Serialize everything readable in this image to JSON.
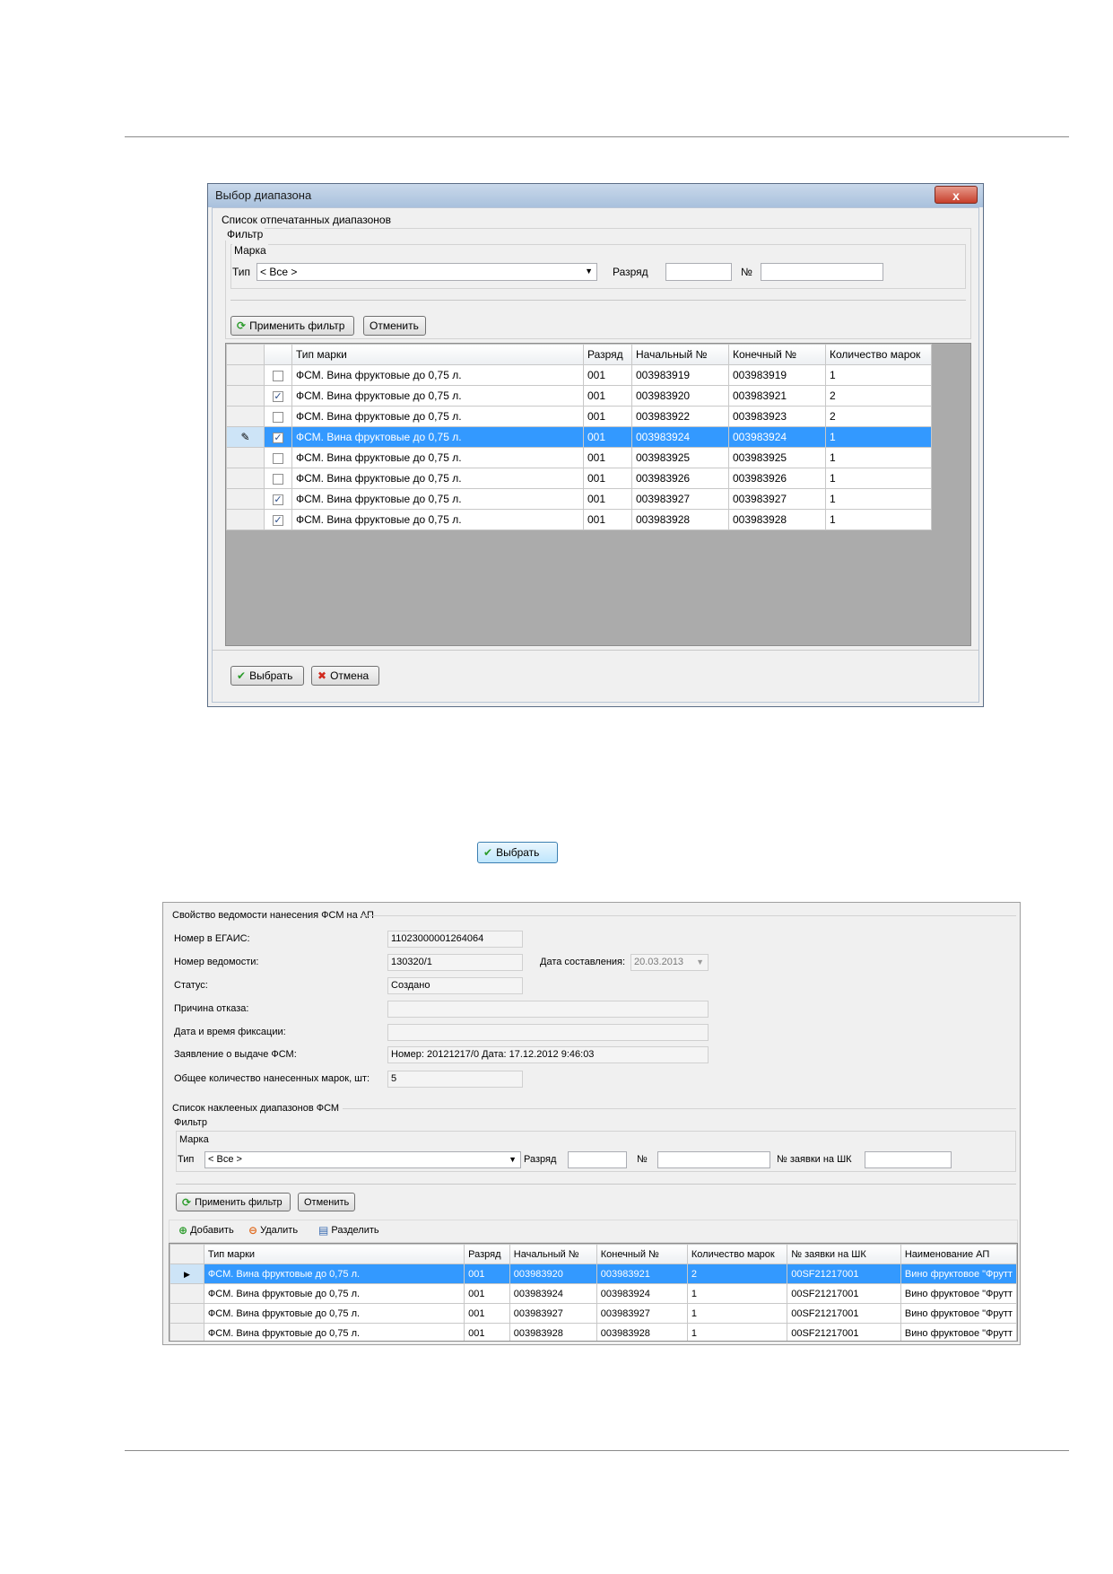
{
  "dialog": {
    "title": "Выбор диапазона",
    "close_glyph": "x",
    "section_label": "Список отпечатанных диапазонов",
    "filter_label": "Фильтр",
    "mark_label": "Марка",
    "type_label": "Тип",
    "type_value": "< Все >",
    "razryad_label": "Разряд",
    "razryad_value": "",
    "number_label": "№",
    "number_value": "",
    "apply_filter": "Применить фильтр",
    "cancel_filter": "Отменить",
    "columns": [
      "Тип марки",
      "Разряд",
      "Начальный №",
      "Конечный №",
      "Количество марок"
    ],
    "rows": [
      {
        "checked": false,
        "type": "ФСМ. Вина фруктовые до 0,75 л.",
        "razryad": "001",
        "start": "003983919",
        "end": "003983919",
        "count": "1"
      },
      {
        "checked": true,
        "type": "ФСМ. Вина фруктовые до 0,75 л.",
        "razryad": "001",
        "start": "003983920",
        "end": "003983921",
        "count": "2"
      },
      {
        "checked": false,
        "type": "ФСМ. Вина фруктовые до 0,75 л.",
        "razryad": "001",
        "start": "003983922",
        "end": "003983923",
        "count": "2"
      },
      {
        "checked": true,
        "type": "ФСМ. Вина фруктовые до 0,75 л.",
        "razryad": "001",
        "start": "003983924",
        "end": "003983924",
        "count": "1"
      },
      {
        "checked": false,
        "type": "ФСМ. Вина фруктовые до 0,75 л.",
        "razryad": "001",
        "start": "003983925",
        "end": "003983925",
        "count": "1"
      },
      {
        "checked": false,
        "type": "ФСМ. Вина фруктовые до 0,75 л.",
        "razryad": "001",
        "start": "003983926",
        "end": "003983926",
        "count": "1"
      },
      {
        "checked": true,
        "type": "ФСМ. Вина фруктовые до 0,75 л.",
        "razryad": "001",
        "start": "003983927",
        "end": "003983927",
        "count": "1"
      },
      {
        "checked": true,
        "type": "ФСМ. Вина фруктовые до 0,75 л.",
        "razryad": "001",
        "start": "003983928",
        "end": "003983928",
        "count": "1"
      }
    ],
    "selected_row_index": 3,
    "choose_button": "Выбрать",
    "cancel_button": "Отмена"
  },
  "standalone_button": "Выбрать",
  "form": {
    "section_title": "Свойство ведомости нанесения ФСМ на АП",
    "egais_label": "Номер в ЕГАИС:",
    "egais_value": "11023000001264064",
    "statement_label": "Номер ведомости:",
    "statement_value": "130320/1",
    "date_label": "Дата составления:",
    "date_value": "20.03.2013",
    "status_label": "Статус:",
    "status_value": "Создано",
    "reason_label": "Причина отказа:",
    "reason_value": "",
    "fix_label": "Дата и время фиксации:",
    "fix_value": "",
    "app_label": "Заявление о выдаче ФСМ:",
    "app_value": "Номер: 20121217/0 Дата: 17.12.2012 9:46:03",
    "total_label": "Общее количество нанесенных марок, шт:",
    "total_value": "5",
    "list_title": "Список наклееных диапазонов ФСМ",
    "filter_label": "Фильтр",
    "mark_label": "Марка",
    "type_label": "Тип",
    "type_value": "< Все >",
    "razryad_label": "Разряд",
    "razryad_value": "",
    "number_label": "№",
    "number_value": "",
    "barcode_label": "№ заявки на ШК",
    "barcode_value": "",
    "apply_filter": "Применить фильтр",
    "cancel_filter": "Отменить",
    "toolbar": {
      "add": "Добавить",
      "delete": "Удалить",
      "split": "Разделить"
    },
    "columns": [
      "Тип марки",
      "Разряд",
      "Начальный №",
      "Конечный №",
      "Количество марок",
      "№ заявки на ШК",
      "Наименование АП"
    ],
    "rows": [
      {
        "type": "ФСМ. Вина фруктовые до 0,75 л.",
        "razryad": "001",
        "start": "003983920",
        "end": "003983921",
        "count": "2",
        "request": "00SF21217001",
        "name": "Вино фруктовое \"Фрутт"
      },
      {
        "type": "ФСМ. Вина фруктовые до 0,75 л.",
        "razryad": "001",
        "start": "003983924",
        "end": "003983924",
        "count": "1",
        "request": "00SF21217001",
        "name": "Вино фруктовое \"Фрутт"
      },
      {
        "type": "ФСМ. Вина фруктовые до 0,75 л.",
        "razryad": "001",
        "start": "003983927",
        "end": "003983927",
        "count": "1",
        "request": "00SF21217001",
        "name": "Вино фруктовое \"Фрутт"
      },
      {
        "type": "ФСМ. Вина фруктовые до 0,75 л.",
        "razryad": "001",
        "start": "003983928",
        "end": "003983928",
        "count": "1",
        "request": "00SF21217001",
        "name": "Вино фруктовое \"Фрутт"
      }
    ],
    "selected_row_index": 0
  },
  "colors": {
    "selection": "#3399ff",
    "grid_bg": "#ababab",
    "window_title": "#a9c1dd"
  },
  "icons": [
    "check-icon",
    "cross-icon",
    "refresh-icon",
    "pencil-icon",
    "add-icon",
    "delete-icon",
    "split-icon",
    "close-icon",
    "dropdown-arrow-icon",
    "row-pointer-icon"
  ]
}
